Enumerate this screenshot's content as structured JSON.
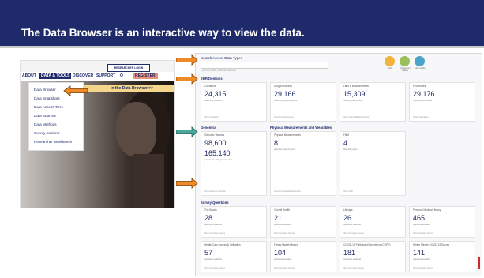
{
  "slide": {
    "title": "The Data Browser is an interactive way to view the data."
  },
  "site": {
    "researcher_login": "RESEARCHER LOGIN",
    "nav": [
      "ABOUT",
      "DATA & TOOLS",
      "DISCOVER",
      "SUPPORT",
      "Q",
      "REGISTER"
    ],
    "banner": "in the Data Browser >>",
    "menu": [
      "Data Browser",
      "Data Snapshots",
      "Data Access Tiers",
      "Data Sources",
      "Data Methods",
      "Survey Explorer",
      "Researcher Workbench"
    ]
  },
  "app": {
    "search_label": "Search Across Data Types",
    "search_hint": "e.g. heart attack, leukemia, diabetes",
    "circle_labels": [
      "FAQs",
      "Introductory Videos",
      "User Guide"
    ],
    "ehr_section": "EHR Domains",
    "ehr_cards": [
      {
        "title": "Conditions",
        "value": "24,315",
        "sub": "matching conditions",
        "foot": "View Conditions"
      },
      {
        "title": "Drug Exposures",
        "value": "29,166",
        "sub": "matching drug exposures",
        "foot": "View Drug Exposures"
      },
      {
        "title": "Labs & Measurements",
        "value": "15,309",
        "sub": "matching lab results",
        "foot": "View Labs & Measurements"
      },
      {
        "title": "Procedures",
        "value": "29,176",
        "sub": "matching procedures",
        "foot": "View Procedures"
      }
    ],
    "genomics_section": "Genomics",
    "pm_section": "Physical Measurements and Wearables",
    "mid_cards": [
      {
        "title": "Genomic Variants",
        "value": "98,600",
        "value2": "165,140",
        "sub": "participants with genomic data",
        "foot": "View Genomic Variants"
      },
      {
        "title": "Physical Measurements",
        "value": "8",
        "sub": "physical measurements",
        "foot": "View Physical Measurements"
      },
      {
        "title": "Fitbit",
        "value": "4",
        "sub": "fitbit data types",
        "foot": "View Fitbit"
      }
    ],
    "survey_section": "Survey Questions",
    "survey_cards": [
      {
        "title": "The Basics",
        "value": "28",
        "sub": "questions available",
        "foot": "View Complete Survey"
      },
      {
        "title": "Overall Health",
        "value": "21",
        "sub": "questions available",
        "foot": "View Complete Survey"
      },
      {
        "title": "Lifestyle",
        "value": "26",
        "sub": "questions available",
        "foot": "View Complete Survey"
      },
      {
        "title": "Personal Medical History",
        "value": "465",
        "sub": "questions available",
        "foot": "View Complete Survey"
      },
      {
        "title": "Health Care Access & Utilization",
        "value": "57",
        "sub": "questions available",
        "foot": "View Complete Survey"
      },
      {
        "title": "Family Health History",
        "value": "104",
        "sub": "questions available",
        "foot": "View Complete Survey"
      },
      {
        "title": "COVID-19 Participant Experience (COPE)",
        "value": "181",
        "sub": "questions available",
        "foot": "View Complete Survey"
      },
      {
        "title": "Winter Minute COVID-19 Survey",
        "value": "141",
        "sub": "questions available",
        "foot": "View Complete Survey"
      }
    ]
  },
  "colors": {
    "title_bar": "#1f2a6b",
    "arrow_orange": "#f08a24",
    "arrow_teal": "#4aa89a"
  }
}
